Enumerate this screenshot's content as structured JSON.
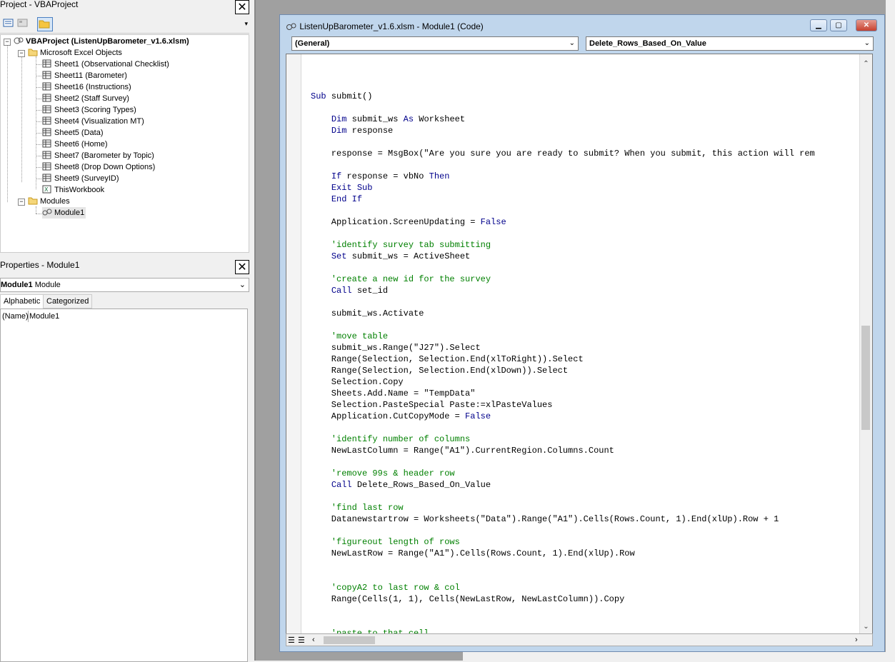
{
  "project_pane": {
    "title": "Project - VBAProject",
    "close_label": "✕",
    "tree": {
      "root": "VBAProject (ListenUpBarometer_v1.6.xlsm)",
      "folder_objects": "Microsoft Excel Objects",
      "sheets": [
        "Sheet1 (Observational Checklist)",
        "Sheet11 (Barometer)",
        "Sheet16 (Instructions)",
        "Sheet2 (Staff Survey)",
        "Sheet3 (Scoring Types)",
        "Sheet4 (Visualization MT)",
        "Sheet5 (Data)",
        "Sheet6 (Home)",
        "Sheet7 (Barometer by Topic)",
        "Sheet8 (Drop Down Options)",
        "Sheet9 (SurveyID)"
      ],
      "workbook": "ThisWorkbook",
      "folder_modules": "Modules",
      "module": "Module1"
    }
  },
  "properties_pane": {
    "title": "Properties - Module1",
    "close_label": "✕",
    "object_name": "Module1",
    "object_type": "Module",
    "tabs": [
      "Alphabetic",
      "Categorized"
    ],
    "rows": [
      {
        "key": "(Name)",
        "value": "Module1"
      }
    ]
  },
  "code_window": {
    "title": "ListenUpBarometer_v1.6.xlsm - Module1 (Code)",
    "object_combo": "(General)",
    "proc_combo": "Delete_Rows_Based_On_Value",
    "lines": [
      {
        "t": "",
        "c": ""
      },
      {
        "t": "Sub submit()",
        "c": "kw-start"
      },
      {
        "t": "",
        "c": ""
      },
      {
        "t": "    Dim submit_ws As Worksheet",
        "c": "dim-as"
      },
      {
        "t": "    Dim response",
        "c": "dim"
      },
      {
        "t": "",
        "c": ""
      },
      {
        "t": "    response = MsgBox(\"Are you sure you are ready to submit? When you submit, this action will rem",
        "c": ""
      },
      {
        "t": "",
        "c": ""
      },
      {
        "t": "    If response = vbNo Then",
        "c": "if"
      },
      {
        "t": "    Exit Sub",
        "c": "kwline"
      },
      {
        "t": "    End If",
        "c": "kwline"
      },
      {
        "t": "",
        "c": ""
      },
      {
        "t": "    Application.ScreenUpdating = False",
        "c": "false"
      },
      {
        "t": "",
        "c": ""
      },
      {
        "t": "    'identify survey tab submitting",
        "c": "cm"
      },
      {
        "t": "    Set submit_ws = ActiveSheet",
        "c": "set"
      },
      {
        "t": "",
        "c": ""
      },
      {
        "t": "    'create a new id for the survey",
        "c": "cm"
      },
      {
        "t": "    Call set_id",
        "c": "call"
      },
      {
        "t": "",
        "c": ""
      },
      {
        "t": "    submit_ws.Activate",
        "c": ""
      },
      {
        "t": "",
        "c": ""
      },
      {
        "t": "    'move table",
        "c": "cm"
      },
      {
        "t": "    submit_ws.Range(\"J27\").Select",
        "c": ""
      },
      {
        "t": "    Range(Selection, Selection.End(xlToRight)).Select",
        "c": ""
      },
      {
        "t": "    Range(Selection, Selection.End(xlDown)).Select",
        "c": ""
      },
      {
        "t": "    Selection.Copy",
        "c": ""
      },
      {
        "t": "    Sheets.Add.Name = \"TempData\"",
        "c": ""
      },
      {
        "t": "    Selection.PasteSpecial Paste:=xlPasteValues",
        "c": ""
      },
      {
        "t": "    Application.CutCopyMode = False",
        "c": "false"
      },
      {
        "t": "",
        "c": ""
      },
      {
        "t": "    'identify number of columns",
        "c": "cm"
      },
      {
        "t": "    NewLastColumn = Range(\"A1\").CurrentRegion.Columns.Count",
        "c": ""
      },
      {
        "t": "",
        "c": ""
      },
      {
        "t": "    'remove 99s & header row",
        "c": "cm"
      },
      {
        "t": "    Call Delete_Rows_Based_On_Value",
        "c": "call"
      },
      {
        "t": "",
        "c": ""
      },
      {
        "t": "    'find last row",
        "c": "cm"
      },
      {
        "t": "    Datanewstartrow = Worksheets(\"Data\").Range(\"A1\").Cells(Rows.Count, 1).End(xlUp).Row + 1",
        "c": ""
      },
      {
        "t": "",
        "c": ""
      },
      {
        "t": "    'figureout length of rows",
        "c": "cm"
      },
      {
        "t": "    NewLastRow = Range(\"A1\").Cells(Rows.Count, 1).End(xlUp).Row",
        "c": ""
      },
      {
        "t": "",
        "c": ""
      },
      {
        "t": "",
        "c": ""
      },
      {
        "t": "    'copyA2 to last row & col",
        "c": "cm"
      },
      {
        "t": "    Range(Cells(1, 1), Cells(NewLastRow, NewLastColumn)).Copy",
        "c": ""
      },
      {
        "t": "",
        "c": ""
      },
      {
        "t": "",
        "c": ""
      },
      {
        "t": "    'paste to that cell",
        "c": "cm"
      }
    ]
  },
  "colors": {
    "keyword": "#00008b",
    "comment": "#008000",
    "title_bar": "#c0d6ec"
  }
}
